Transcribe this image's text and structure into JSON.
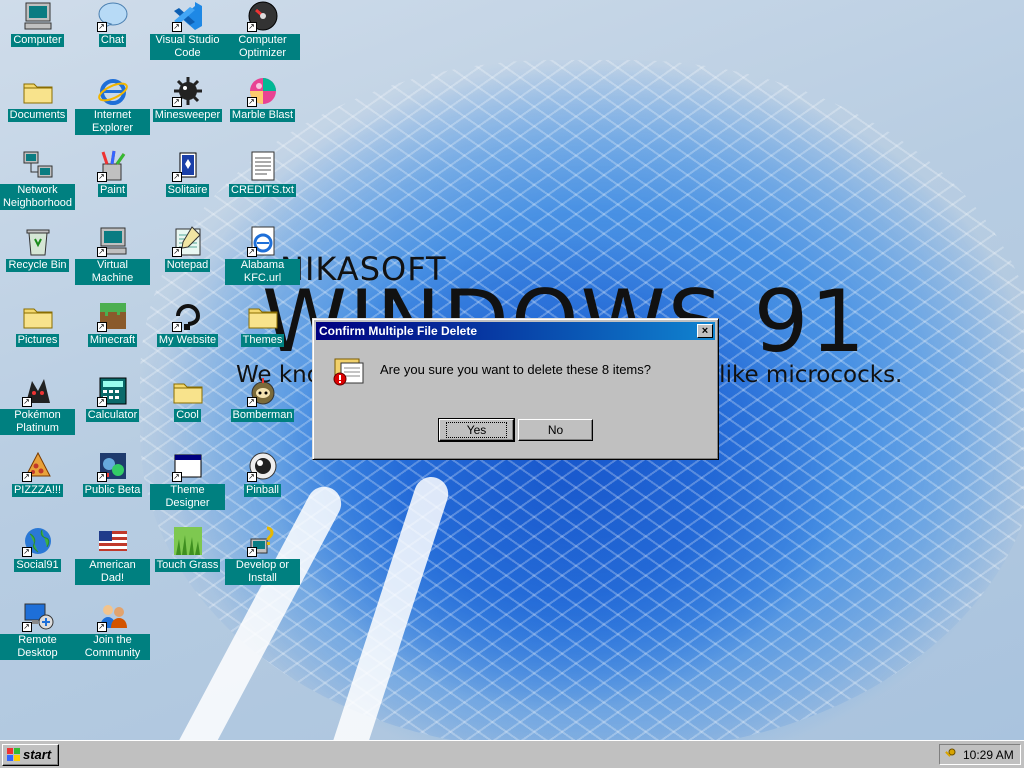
{
  "wallpaper": {
    "brand_sub": "NIKASOFT",
    "brand_main": "WINDOWS 91",
    "brand_tag": "We know what we're doing, probably. Not like micrococks."
  },
  "desktop_icons": [
    {
      "label": "Computer",
      "icon": "computer-icon",
      "shortcut": false
    },
    {
      "label": "Chat",
      "icon": "chat-bubble-icon",
      "shortcut": true
    },
    {
      "label": "Visual Studio Code",
      "icon": "vscode-icon",
      "shortcut": true
    },
    {
      "label": "Computer Optimizer",
      "icon": "gauge-icon",
      "shortcut": true
    },
    {
      "label": "Documents",
      "icon": "folder-icon",
      "shortcut": false
    },
    {
      "label": "Internet Explorer",
      "icon": "internet-explorer-icon",
      "shortcut": false
    },
    {
      "label": "Minesweeper",
      "icon": "mine-icon",
      "shortcut": true
    },
    {
      "label": "Marble Blast",
      "icon": "marble-icon",
      "shortcut": true
    },
    {
      "label": "Network Neighborhood",
      "icon": "network-icon",
      "shortcut": false
    },
    {
      "label": "Paint",
      "icon": "paint-icon",
      "shortcut": true
    },
    {
      "label": "Solitaire",
      "icon": "cards-icon",
      "shortcut": true
    },
    {
      "label": "CREDITS.txt",
      "icon": "text-file-icon",
      "shortcut": false
    },
    {
      "label": "Recycle Bin",
      "icon": "recycle-bin-icon",
      "shortcut": false
    },
    {
      "label": "Virtual Machine",
      "icon": "computer-icon",
      "shortcut": true
    },
    {
      "label": "Notepad",
      "icon": "notepad-icon",
      "shortcut": true
    },
    {
      "label": "Alabama KFC.url",
      "icon": "url-icon",
      "shortcut": true
    },
    {
      "label": "Pictures",
      "icon": "folder-icon",
      "shortcut": false
    },
    {
      "label": "Minecraft",
      "icon": "grass-block-icon",
      "shortcut": true
    },
    {
      "label": "My Website",
      "icon": "website-icon",
      "shortcut": true
    },
    {
      "label": "Themes",
      "icon": "folder-icon",
      "shortcut": false
    },
    {
      "label": "Pokémon Platinum",
      "icon": "pokemon-icon",
      "shortcut": true
    },
    {
      "label": "Calculator",
      "icon": "calculator-icon",
      "shortcut": true
    },
    {
      "label": "Cool",
      "icon": "folder-icon",
      "shortcut": false
    },
    {
      "label": "Bomberman",
      "icon": "bomberman-icon",
      "shortcut": true
    },
    {
      "label": "PIZZZA!!!",
      "icon": "pizza-icon",
      "shortcut": true
    },
    {
      "label": "Public Beta",
      "icon": "beta-icon",
      "shortcut": true
    },
    {
      "label": "Theme Designer",
      "icon": "window-icon",
      "shortcut": true
    },
    {
      "label": "Pinball",
      "icon": "pinball-icon",
      "shortcut": true
    },
    {
      "label": "Social91",
      "icon": "globe-icon",
      "shortcut": true
    },
    {
      "label": "American Dad!",
      "icon": "us-flag-icon",
      "shortcut": false
    },
    {
      "label": "Touch Grass",
      "icon": "grass-icon",
      "shortcut": false
    },
    {
      "label": "Develop or Install",
      "icon": "setup-icon",
      "shortcut": true
    },
    {
      "label": "Remote Desktop",
      "icon": "remote-desktop-icon",
      "shortcut": true
    },
    {
      "label": "Join the Community",
      "icon": "community-icon",
      "shortcut": true
    }
  ],
  "dialog": {
    "title": "Confirm Multiple File Delete",
    "close_label": "×",
    "message": "Are you sure you want to delete these 8 items?",
    "yes_label": "Yes",
    "no_label": "No",
    "icon": "delete-files-icon"
  },
  "taskbar": {
    "start_label": "start",
    "clock": "10:29 AM",
    "tray_icon": "key-icon"
  },
  "colors": {
    "desktop_label_bg": "#008080",
    "dialog_title_start": "#000080",
    "dialog_title_end": "#1084d0",
    "face": "#c0c0c0"
  }
}
